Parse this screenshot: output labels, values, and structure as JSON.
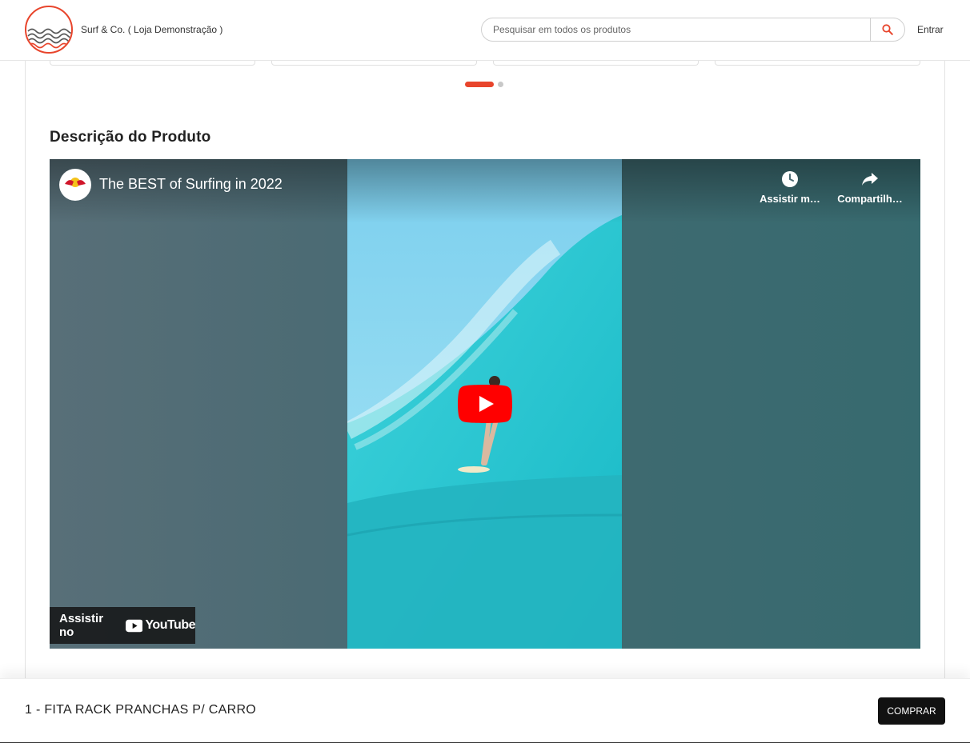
{
  "header": {
    "store_name": "Surf & Co. ( Loja Demonstração )",
    "search_placeholder": "Pesquisar em todos os produtos",
    "login_label": "Entrar",
    "accent_color": "#e8452c"
  },
  "carousel": {
    "page_count": 2,
    "active_page": 1
  },
  "description": {
    "title": "Descrição do Produto"
  },
  "video": {
    "title": "The BEST of Surfing in 2022",
    "channel_logo_text": "Red Bull",
    "watch_later_label": "Assistir m…",
    "share_label": "Compartilh…",
    "watch_on_label": "Assistir no",
    "youtube_label": "YouTube",
    "icons": [
      "clock-icon",
      "share-icon",
      "play-icon",
      "youtube-icon"
    ]
  },
  "bottom_bar": {
    "product_name": "1 - FITA RACK PRANCHAS P/ CARRO",
    "buy_label": "COMPRAR"
  }
}
